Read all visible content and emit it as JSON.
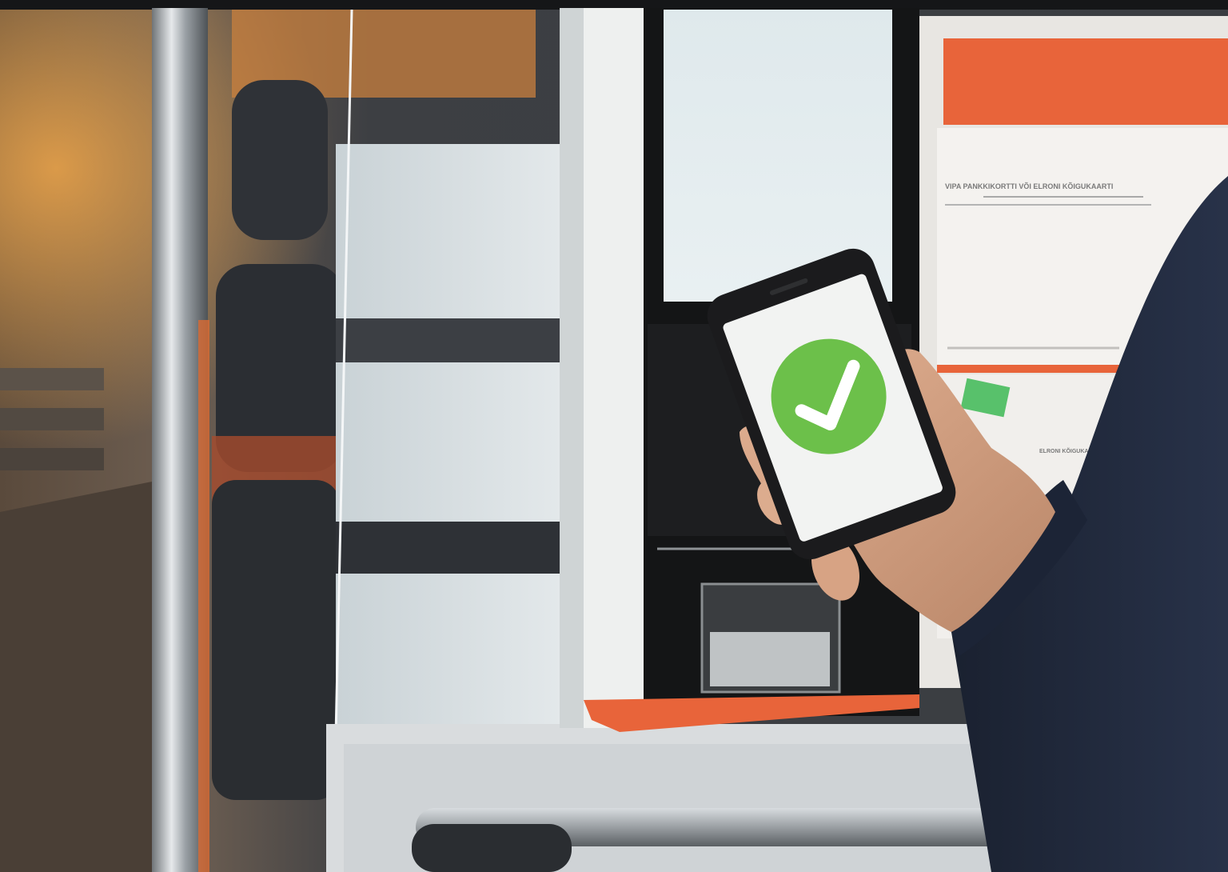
{
  "scene": {
    "description_visible": "photo",
    "colors": {
      "validator_white": "#eef0ef",
      "validator_black": "#141516",
      "accent_orange": "#e8643a",
      "check_green": "#6cc04a",
      "phone_body": "#1b1b1d",
      "sleeve_navy": "#1f2738",
      "skin": "#d9a88a",
      "seat_dark": "#2e3136"
    },
    "phone": {
      "status_icon": "checkmark-icon"
    },
    "sign": {
      "line_1": "VIPA PANKKIKORTTI VÕI ELRONI KÕIGUKAARTI",
      "line_2": "ELRONI KÕIGUKAARTI"
    }
  }
}
